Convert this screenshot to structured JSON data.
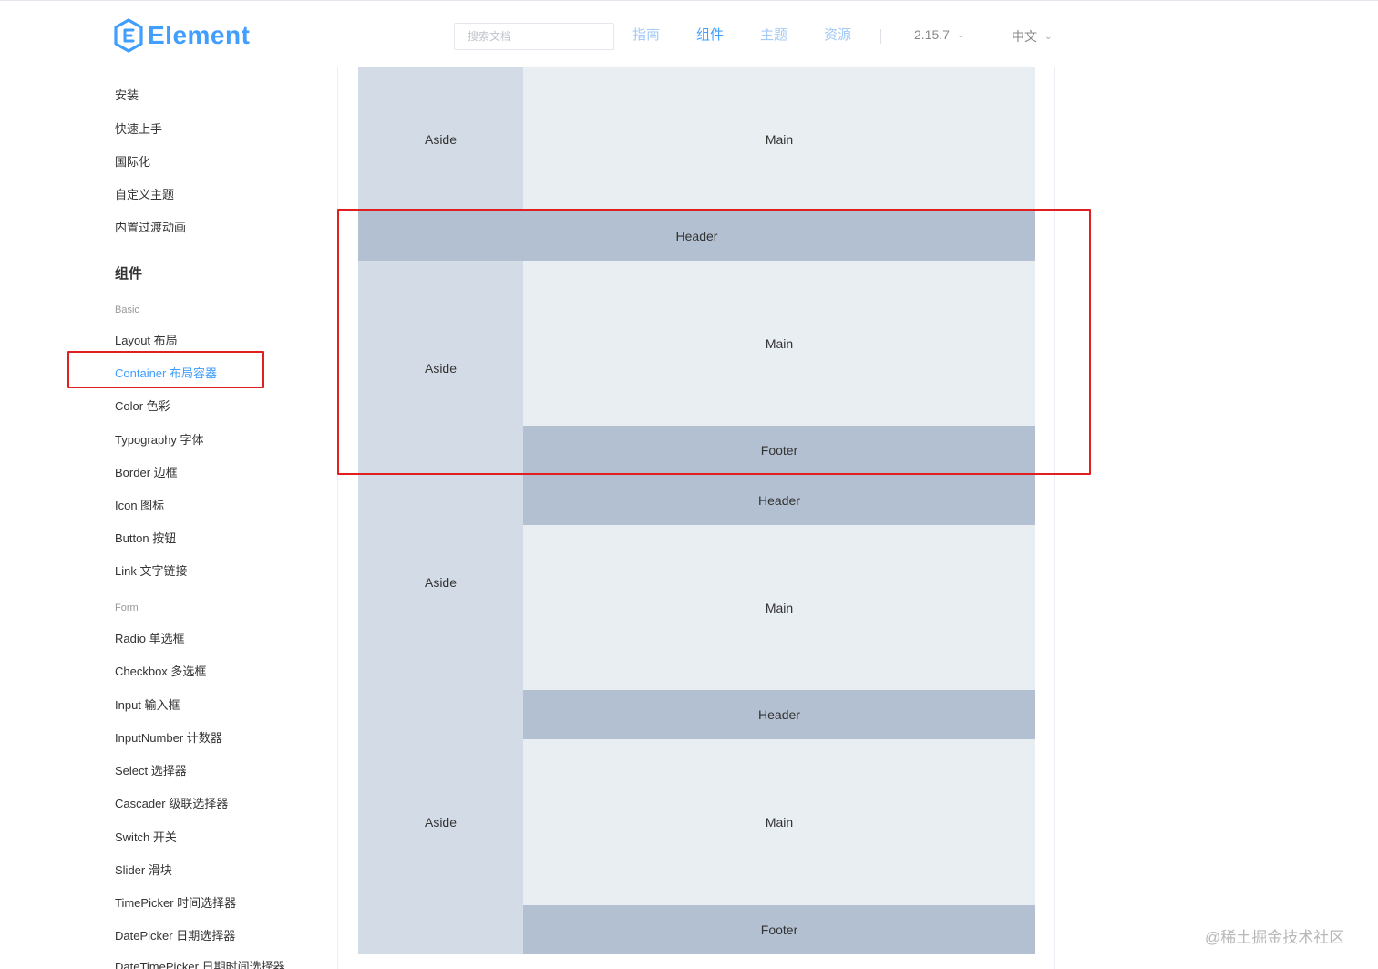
{
  "header": {
    "logo_text": "Element",
    "search_placeholder": "搜索文档",
    "nav": [
      "指南",
      "组件",
      "主题",
      "资源"
    ],
    "active_nav": "组件",
    "version": "2.15.7",
    "language": "中文"
  },
  "sidebar": {
    "guide_items": [
      "安装",
      "快速上手",
      "国际化",
      "自定义主题",
      "内置过渡动画"
    ],
    "components_title": "组件",
    "basic_group": "Basic",
    "basic_items": [
      "Layout 布局",
      "Container 布局容器",
      "Color 色彩",
      "Typography 字体",
      "Border 边框",
      "Icon 图标",
      "Button 按钮",
      "Link 文字链接"
    ],
    "active_item": "Container 布局容器",
    "form_group": "Form",
    "form_items": [
      "Radio 单选框",
      "Checkbox 多选框",
      "Input 输入框",
      "InputNumber 计数器",
      "Select 选择器",
      "Cascader 级联选择器",
      "Switch 开关",
      "Slider 滑块",
      "TimePicker 时间选择器",
      "DatePicker 日期选择器",
      "DateTimePicker 日期时间选择器"
    ]
  },
  "demo": {
    "aside": "Aside",
    "main": "Main",
    "header": "Header",
    "footer": "Footer"
  },
  "colors": {
    "accent": "#409eff",
    "aside_bg": "#d3dce6",
    "main_bg": "#e9eef3",
    "header_footer_bg": "#b3c0d1",
    "highlight_border": "#e02020"
  },
  "watermark": "@稀土掘金技术社区"
}
